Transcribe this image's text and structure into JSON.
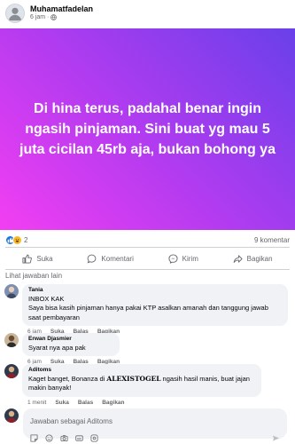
{
  "post": {
    "author": "Muhamatfadelan",
    "time": "6 jam ·",
    "banner_text": "Di hina terus, padahal benar ingin ngasih pinjaman. Sini buat yg mau 5 juta cicilan 45rb aja, bukan bohong ya",
    "banner_colors": [
      "#f33ef2",
      "#6940ea"
    ],
    "reaction_count": "2",
    "comment_count": "9 komentar"
  },
  "actions": {
    "like": "Suka",
    "comment": "Komentari",
    "send": "Kirim",
    "share": "Bagikan"
  },
  "comments_header": "Lihat jawaban lain",
  "comments": [
    {
      "name": "Tania",
      "line1": "INBOX KAK",
      "line2": "Saya bisa kasih pinjaman hanya pakai KTP asalkan amanah dan tanggung jawab saat pembayaran",
      "time": "6 jam",
      "like": "Suka",
      "reply": "Balas",
      "share": "Bagikan"
    },
    {
      "name": "Erwan Djasmier",
      "text": "Syarat nya apa pak",
      "time": "6 jam",
      "like": "Suka",
      "reply": "Balas",
      "share": "Bagikan"
    },
    {
      "name": "Aditoms",
      "text_before": "Kaget banget, Bonanza di ",
      "highlight": "ALEXISTOGEL",
      "text_after": " ngasih hasil manis, buat jajan makin banyak!",
      "time": "1 menit",
      "like": "Suka",
      "reply": "Balas",
      "share": "Bagikan"
    }
  ],
  "compose": {
    "placeholder": "Jawaban sebagai Aditoms"
  },
  "icons": {
    "like": "thumbs-up-icon",
    "comment": "speech-bubble-icon",
    "send": "messenger-icon",
    "share": "share-arrow-icon",
    "compose": [
      "sticker-icon",
      "emoji-icon",
      "camera-icon",
      "gif-icon",
      "sticker-alt-icon"
    ]
  }
}
